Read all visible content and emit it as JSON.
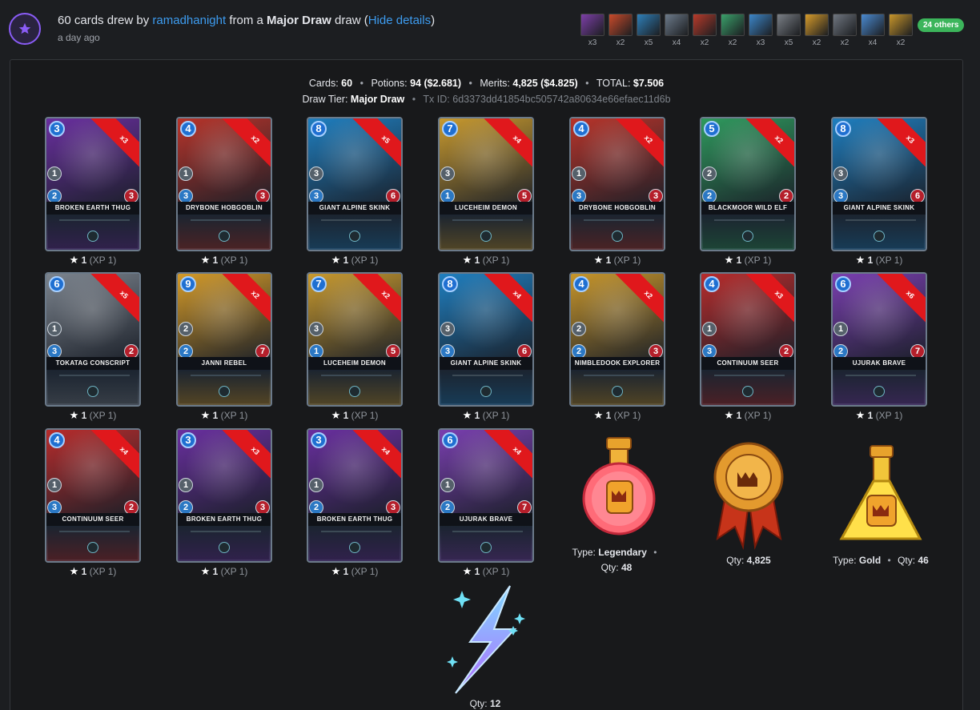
{
  "header": {
    "count_text": "60 cards drew by",
    "user": "ramadhanight",
    "from_text": "from a",
    "draw_name": "Major Draw",
    "draw_suffix": "draw (",
    "hide_details": "Hide details",
    "close_paren": ")",
    "time": "a day ago"
  },
  "thumbs": [
    {
      "qty": "x3",
      "color": "#7d3fa8"
    },
    {
      "qty": "x2",
      "color": "#c94a2a"
    },
    {
      "qty": "x5",
      "color": "#2e7fb8"
    },
    {
      "qty": "x4",
      "color": "#6c7a8a"
    },
    {
      "qty": "x2",
      "color": "#b83a2a"
    },
    {
      "qty": "x2",
      "color": "#3aa06a"
    },
    {
      "qty": "x3",
      "color": "#3c86c8"
    },
    {
      "qty": "x5",
      "color": "#7a7f86"
    },
    {
      "qty": "x2",
      "color": "#d69b2a"
    },
    {
      "qty": "x2",
      "color": "#6f7680"
    },
    {
      "qty": "x4",
      "color": "#4a8ad0"
    },
    {
      "qty": "x2",
      "color": "#c8962a"
    }
  ],
  "others": "24 others",
  "summary": {
    "cards_label": "Cards:",
    "cards_value": "60",
    "potions_label": "Potions:",
    "potions_value": "94 ($2.681)",
    "merits_label": "Merits:",
    "merits_value": "4,825 ($4.825)",
    "total_label": "TOTAL:",
    "total_value": "$7.506",
    "tier_label": "Draw Tier:",
    "tier_value": "Major Draw",
    "tx_label": "Tx ID:",
    "tx_value": "6d3373dd41854bc505742a80634e66efaec11d6b"
  },
  "level_text": {
    "star": "★",
    "level": "1",
    "xp": "(XP 1)"
  },
  "cards": [
    {
      "name": "BROKEN EARTH THUG",
      "mana": "3",
      "atk": "1",
      "spd": "2",
      "hp": "3",
      "qty": "x3",
      "color": "#6a2fa0"
    },
    {
      "name": "DRYBONE HOBGOBLIN",
      "mana": "4",
      "atk": "1",
      "spd": "3",
      "hp": "3",
      "qty": "x2",
      "color": "#b8342a"
    },
    {
      "name": "GIANT ALPINE SKINK",
      "mana": "8",
      "atk": "3",
      "spd": "3",
      "hp": "6",
      "qty": "x5",
      "color": "#1f7fc0"
    },
    {
      "name": "LUCEHEIM DEMON",
      "mana": "7",
      "atk": "3",
      "spd": "1",
      "hp": "5",
      "qty": "x4",
      "color": "#c99a2e"
    },
    {
      "name": "DRYBONE HOBGOBLIN",
      "mana": "4",
      "atk": "1",
      "spd": "3",
      "hp": "3",
      "qty": "x2",
      "color": "#b8342a"
    },
    {
      "name": "BLACKMOOR WILD ELF",
      "mana": "5",
      "atk": "2",
      "spd": "2",
      "hp": "2",
      "qty": "x2",
      "color": "#2f9a5e"
    },
    {
      "name": "GIANT ALPINE SKINK",
      "mana": "8",
      "atk": "3",
      "spd": "3",
      "hp": "6",
      "qty": "x3",
      "color": "#1f7fc0"
    },
    {
      "name": "TOKATAG CONSCRIPT",
      "mana": "6",
      "atk": "1",
      "spd": "3",
      "hp": "2",
      "qty": "x5",
      "color": "#7c848e"
    },
    {
      "name": "JANNI REBEL",
      "mana": "9",
      "atk": "2",
      "spd": "2",
      "hp": "7",
      "qty": "x2",
      "color": "#d49a28"
    },
    {
      "name": "LUCEHEIM DEMON",
      "mana": "7",
      "atk": "3",
      "spd": "1",
      "hp": "5",
      "qty": "x2",
      "color": "#c99a2e"
    },
    {
      "name": "GIANT ALPINE SKINK",
      "mana": "8",
      "atk": "3",
      "spd": "3",
      "hp": "6",
      "qty": "x4",
      "color": "#1f7fc0"
    },
    {
      "name": "NIMBLEDOOK EXPLORER",
      "mana": "4",
      "atk": "2",
      "spd": "2",
      "hp": "3",
      "qty": "x2",
      "color": "#c8962a"
    },
    {
      "name": "CONTINUUM SEER",
      "mana": "4",
      "atk": "1",
      "spd": "3",
      "hp": "2",
      "qty": "x3",
      "color": "#b82c2c"
    },
    {
      "name": "UJURAK BRAVE",
      "mana": "6",
      "atk": "1",
      "spd": "2",
      "hp": "7",
      "qty": "x6",
      "color": "#7a3fb0"
    },
    {
      "name": "CONTINUUM SEER",
      "mana": "4",
      "atk": "1",
      "spd": "3",
      "hp": "2",
      "qty": "x4",
      "color": "#b82c2c"
    },
    {
      "name": "BROKEN EARTH THUG",
      "mana": "3",
      "atk": "1",
      "spd": "2",
      "hp": "3",
      "qty": "x3",
      "color": "#6a2fa0"
    },
    {
      "name": "BROKEN EARTH THUG",
      "mana": "3",
      "atk": "1",
      "spd": "2",
      "hp": "3",
      "qty": "x4",
      "color": "#6a2fa0"
    },
    {
      "name": "UJURAK BRAVE",
      "mana": "6",
      "atk": "1",
      "spd": "2",
      "hp": "7",
      "qty": "x4",
      "color": "#7a3fb0"
    }
  ],
  "rewards": {
    "legendary_potion": {
      "type_label": "Type:",
      "type_value": "Legendary",
      "qty_label": "Qty:",
      "qty_value": "48"
    },
    "merits": {
      "qty_label": "Qty:",
      "qty_value": "4,825"
    },
    "gold_potion": {
      "type_label": "Type:",
      "type_value": "Gold",
      "qty_label": "Qty:",
      "qty_value": "46"
    },
    "energy": {
      "qty_label": "Qty:",
      "qty_value": "12"
    }
  }
}
